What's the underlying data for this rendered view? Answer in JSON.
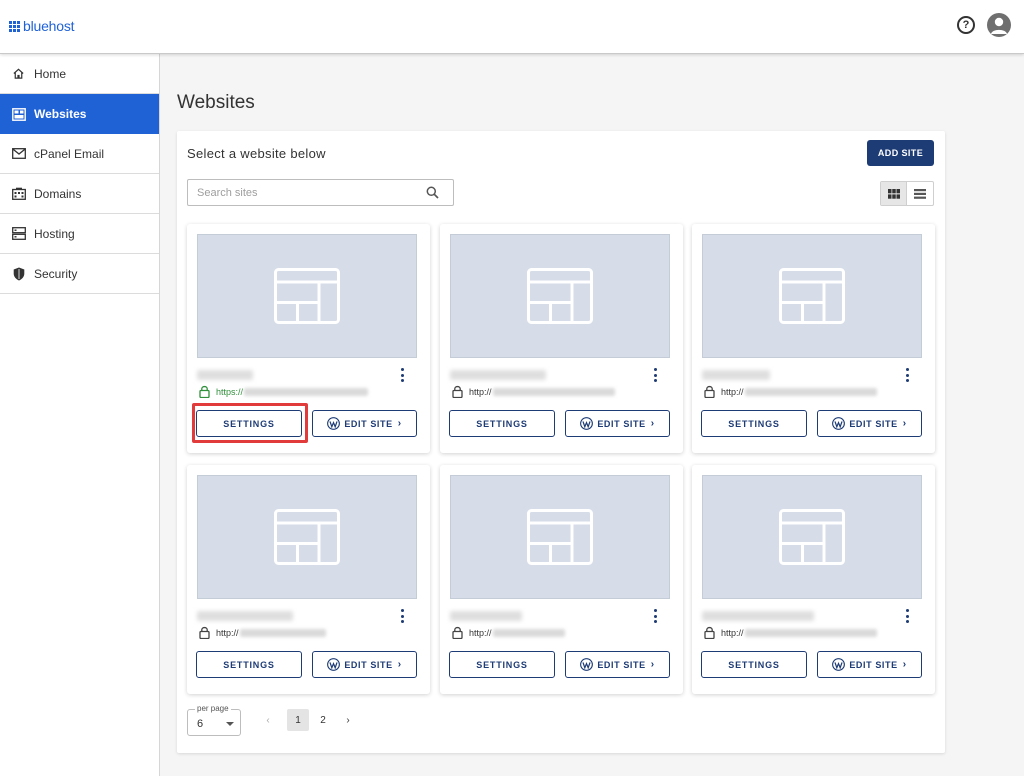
{
  "brand": {
    "name": "bluehost",
    "accent": "#1f62d6",
    "dark": "#1d3b75"
  },
  "header": {
    "help_icon": "help-circle-icon",
    "help_glyph": "?",
    "user_icon": "user-avatar-icon"
  },
  "sidebar": {
    "items": [
      {
        "label": "Home",
        "icon": "home-icon"
      },
      {
        "label": "Websites",
        "icon": "websites-icon",
        "active": true
      },
      {
        "label": "cPanel Email",
        "icon": "mail-icon"
      },
      {
        "label": "Domains",
        "icon": "domains-icon"
      },
      {
        "label": "Hosting",
        "icon": "hosting-icon"
      },
      {
        "label": "Security",
        "icon": "shield-icon"
      }
    ]
  },
  "main": {
    "title": "Websites",
    "panel_title": "Select a website below",
    "add_site_label": "ADD SITE",
    "search_placeholder": "Search sites",
    "view_toggle": {
      "selected": "grid",
      "options": [
        "grid-view-icon",
        "list-view-icon"
      ]
    },
    "sites": [
      {
        "protocol": "https://",
        "secure": true,
        "settings_label": "SETTINGS",
        "edit_label": "EDIT SITE"
      },
      {
        "protocol": "http://",
        "secure": false,
        "settings_label": "SETTINGS",
        "edit_label": "EDIT SITE"
      },
      {
        "protocol": "http://",
        "secure": false,
        "settings_label": "SETTINGS",
        "edit_label": "EDIT SITE"
      },
      {
        "protocol": "http://",
        "secure": false,
        "settings_label": "SETTINGS",
        "edit_label": "EDIT SITE"
      },
      {
        "protocol": "http://",
        "secure": false,
        "settings_label": "SETTINGS",
        "edit_label": "EDIT SITE"
      },
      {
        "protocol": "http://",
        "secure": false,
        "settings_label": "SETTINGS",
        "edit_label": "EDIT SITE"
      }
    ],
    "pagination": {
      "per_page_label": "per page",
      "per_page_value": "6",
      "prev_glyph": "‹",
      "next_glyph": "›",
      "pages": [
        "1",
        "2"
      ],
      "current_page": "1"
    }
  }
}
